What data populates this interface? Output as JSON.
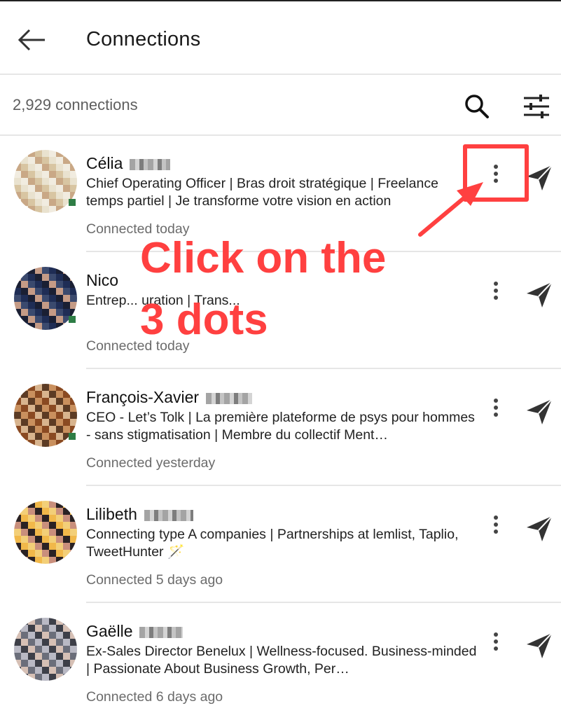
{
  "header": {
    "title": "Connections",
    "back_icon": "back-arrow-icon"
  },
  "toolbar": {
    "count_label": "2,929 connections",
    "search_icon": "search-icon",
    "filter_icon": "filter-sliders-icon"
  },
  "connections": [
    {
      "first_name": "Célia",
      "headline": "Chief Operating Officer | Bras droit stratégique | Freelance temps partiel | Je transforme votre vision en action",
      "connected": "Connected today",
      "online": true,
      "avatar_colors": [
        "#e9e2cf",
        "#d8c5a2",
        "#c9a886",
        "#f1ece0"
      ]
    },
    {
      "first_name": "Nico",
      "headline": "Entrep... uration | Trans...",
      "connected": "Connected today",
      "online": true,
      "avatar_colors": [
        "#1f2d55",
        "#3b4a6e",
        "#c59b86",
        "#1a1f33"
      ]
    },
    {
      "first_name": "François-Xavier",
      "headline": "CEO - Let’s Tolk | La première plateforme de psys pour hommes - sans stigmatisation | Membre du collectif Ment…",
      "connected": "Connected yesterday",
      "online": true,
      "avatar_colors": [
        "#8a4a22",
        "#c9905e",
        "#5c3b24",
        "#d8b48e"
      ]
    },
    {
      "first_name": "Lilibeth",
      "headline": "Connecting type A companies | Partnerships at lemlist, Taplio, TweetHunter 🪄",
      "connected": "Connected 5 days ago",
      "online": false,
      "avatar_colors": [
        "#f1b84a",
        "#2a2224",
        "#c98f7c",
        "#f3cf78"
      ]
    },
    {
      "first_name": "Gaëlle",
      "headline": "Ex-Sales Director Benelux | Wellness-focused. Business-minded | Passionate About Business Growth, Per…",
      "connected": "Connected 6 days ago",
      "online": false,
      "avatar_colors": [
        "#b9b9c4",
        "#6b6e7a",
        "#d6c0b5",
        "#3d3f48"
      ]
    }
  ],
  "annotation": {
    "line1": "Click on the",
    "line2": "3 dots",
    "color": "#ff4040"
  },
  "colors": {
    "accent_red": "#ff4040",
    "presence_green": "#2e7d45",
    "divider": "#e6e6e6"
  }
}
